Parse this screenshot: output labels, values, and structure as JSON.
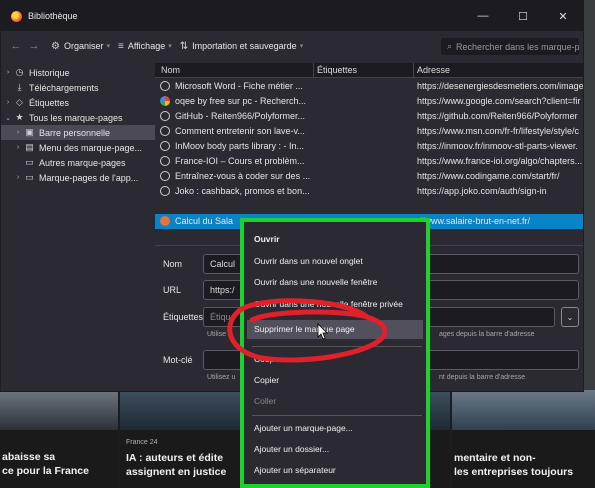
{
  "window": {
    "title": "Bibliothèque",
    "icon": "firefox-library-icon",
    "controls": [
      "—",
      "☐",
      "✕"
    ]
  },
  "toolbar": {
    "back": "←",
    "forward": "→",
    "organize": "Organiser",
    "view": "Affichage",
    "import": "Importation et sauvegarde",
    "search_placeholder": "Rechercher dans les marque-p"
  },
  "sidebar": {
    "items": [
      {
        "label": "Historique",
        "icon": "clock-icon"
      },
      {
        "label": "Téléchargements",
        "icon": "download-icon"
      },
      {
        "label": "Étiquettes",
        "icon": "tag-icon"
      },
      {
        "label": "Tous les marque-pages",
        "icon": "star-icon"
      },
      {
        "label": "Barre personnelle",
        "icon": "toolbar-icon"
      },
      {
        "label": "Menu des marque-page...",
        "icon": "menu-icon"
      },
      {
        "label": "Autres marque-pages",
        "icon": "folder-icon"
      },
      {
        "label": "Marque-pages de l'app...",
        "icon": "folder-icon"
      }
    ]
  },
  "table": {
    "columns": [
      "Nom",
      "Étiquettes",
      "Adresse"
    ],
    "rows": [
      {
        "name": "Microsoft Word - Fiche métier ...",
        "url": "https://desenergiesdesmetiers.com/image"
      },
      {
        "name": "oqee by free sur pc - Recherch...",
        "url": "https://www.google.com/search?client=fir"
      },
      {
        "name": "GitHub - Reiten966/Polyformer...",
        "url": "https://github.com/Reiten966/Polyformer"
      },
      {
        "name": "Comment entretenir son lave-v...",
        "url": "https://www.msn.com/fr-fr/lifestyle/style/c"
      },
      {
        "name": "InMoov body parts library : - In...",
        "url": "https://inmoov.fr/inmoov-stl-parts-viewer."
      },
      {
        "name": "France-IOI – Cours et problèm...",
        "url": "https://www.france-ioi.org/algo/chapters..."
      },
      {
        "name": "Entraînez-vous à coder sur des ...",
        "url": "https://www.codingame.com/start/fr/"
      },
      {
        "name": "Joko : cashback, promos et bon...",
        "url": "https://app.joko.com/auth/sign-in"
      },
      {
        "name": "Calcul du Sala",
        "url": "://www.salaire-brut-en-net.fr/"
      }
    ]
  },
  "details": {
    "name_label": "Nom",
    "name_value": "Calcul",
    "url_label": "URL",
    "url_value": "https:/",
    "tags_label": "Étiquettes",
    "tags_placeholder": "Étiqu",
    "tags_hint_left": "Utilise",
    "tags_hint_right": "ages depuis la barre d'adresse",
    "keyword_label": "Mot-clé",
    "keyword_hint_left": "Utilisez u",
    "keyword_hint_right": "nt depuis la barre d'adresse"
  },
  "context_menu": {
    "items": [
      "Ouvrir",
      "Ouvrir dans un nouvel onglet",
      "Ouvrir dans une nouvelle fenêtre",
      "Ouvrir dans une nouvelle fenêtre privée",
      "Supprimer le marque page",
      "Couper",
      "Copier",
      "Coller",
      "Ajouter un marque-page...",
      "Ajouter un dossier...",
      "Ajouter un séparateur"
    ]
  },
  "background_page": {
    "cards": [
      {
        "source": "",
        "title_1": "abaisse sa",
        "title_2": "ce pour la France"
      },
      {
        "source": "France 24",
        "title_1": "IA : auteurs et édite",
        "title_2": "assignent en justice"
      },
      {
        "source": "",
        "title_1": "mentaire et non-",
        "title_2": "les entreprises toujours"
      }
    ]
  },
  "colors": {
    "selection": "#0a84c7",
    "annotation_box": "#1cd32e",
    "annotation_scribble": "#e0202a"
  }
}
